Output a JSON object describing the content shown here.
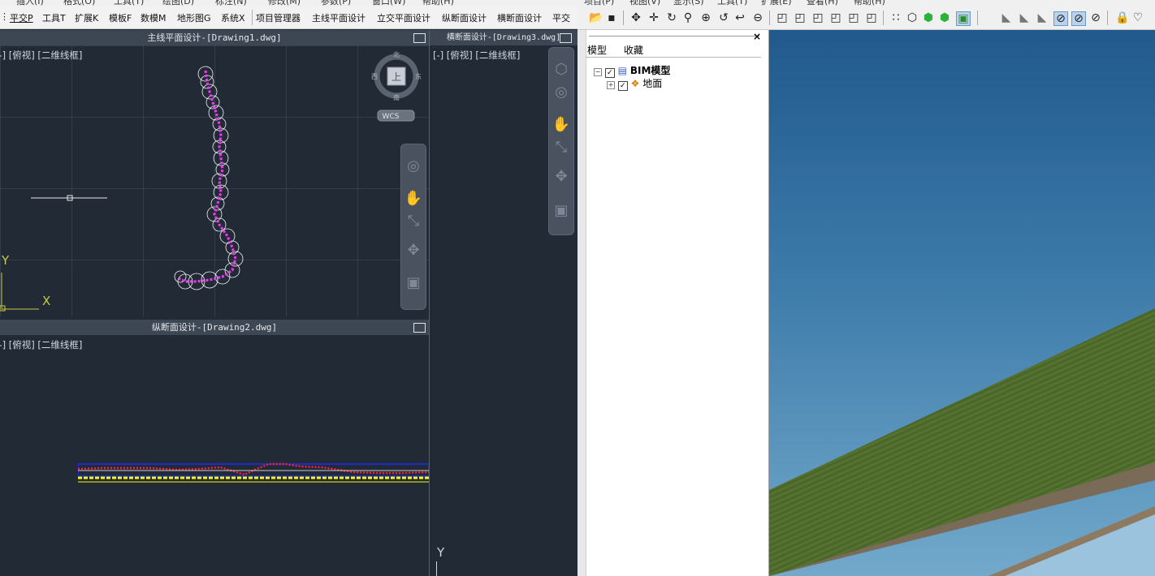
{
  "cad": {
    "menubar": [
      "插入(I)",
      "格式(O)",
      "工具(T)",
      "绘图(D)",
      "标注(N)",
      "修改(M)",
      "参数(P)",
      "窗口(W)",
      "帮助(H)"
    ],
    "toolbar_items": [
      "平交P",
      "工具T",
      "扩展K",
      "模板F",
      "数模M",
      "地形图G",
      "系统X",
      "项目管理器",
      "主线平面设计",
      "立交平面设计",
      "纵断面设计",
      "横断面设计",
      "平交"
    ],
    "viewport_plan": {
      "title": "主线平面设计-[Drawing1.dwg]",
      "label": "[-] [俯视] [二维线框]",
      "viewcube": {
        "north": "北",
        "south": "南",
        "east": "东",
        "west": "西",
        "face": "上",
        "wcs": "WCS"
      },
      "ucs": {
        "x": "X",
        "y": "Y"
      }
    },
    "viewport_profile": {
      "title": "纵断面设计-[Drawing2.dwg]",
      "label": "[-] [俯视] [二维线框]"
    },
    "viewport_cross": {
      "title": "横断面设计-[Drawing3.dwg]",
      "label": "[-] [俯视] [二维线框]",
      "ucs_y": "Y"
    },
    "colors": {
      "background": "#222a36",
      "route": "#e23de6",
      "profile_red": "#ff2040",
      "profile_yellow": "#ffff00",
      "profile_blue": "#1a2cff"
    }
  },
  "bim": {
    "menubar": [
      "项目(P)",
      "视图(V)",
      "显示(S)",
      "工具(T)",
      "扩展(E)",
      "查看(H)",
      "帮助(H)"
    ],
    "panel": {
      "tabs": [
        "模型",
        "收藏"
      ],
      "tree": [
        {
          "label": "BIM模型",
          "bold": true
        },
        {
          "label": "地面",
          "bold": false
        }
      ],
      "close": "×"
    },
    "colors": {
      "sky": "#3c7aa9",
      "terrain": "#4f6a2e",
      "base": "#7a6a58"
    }
  }
}
